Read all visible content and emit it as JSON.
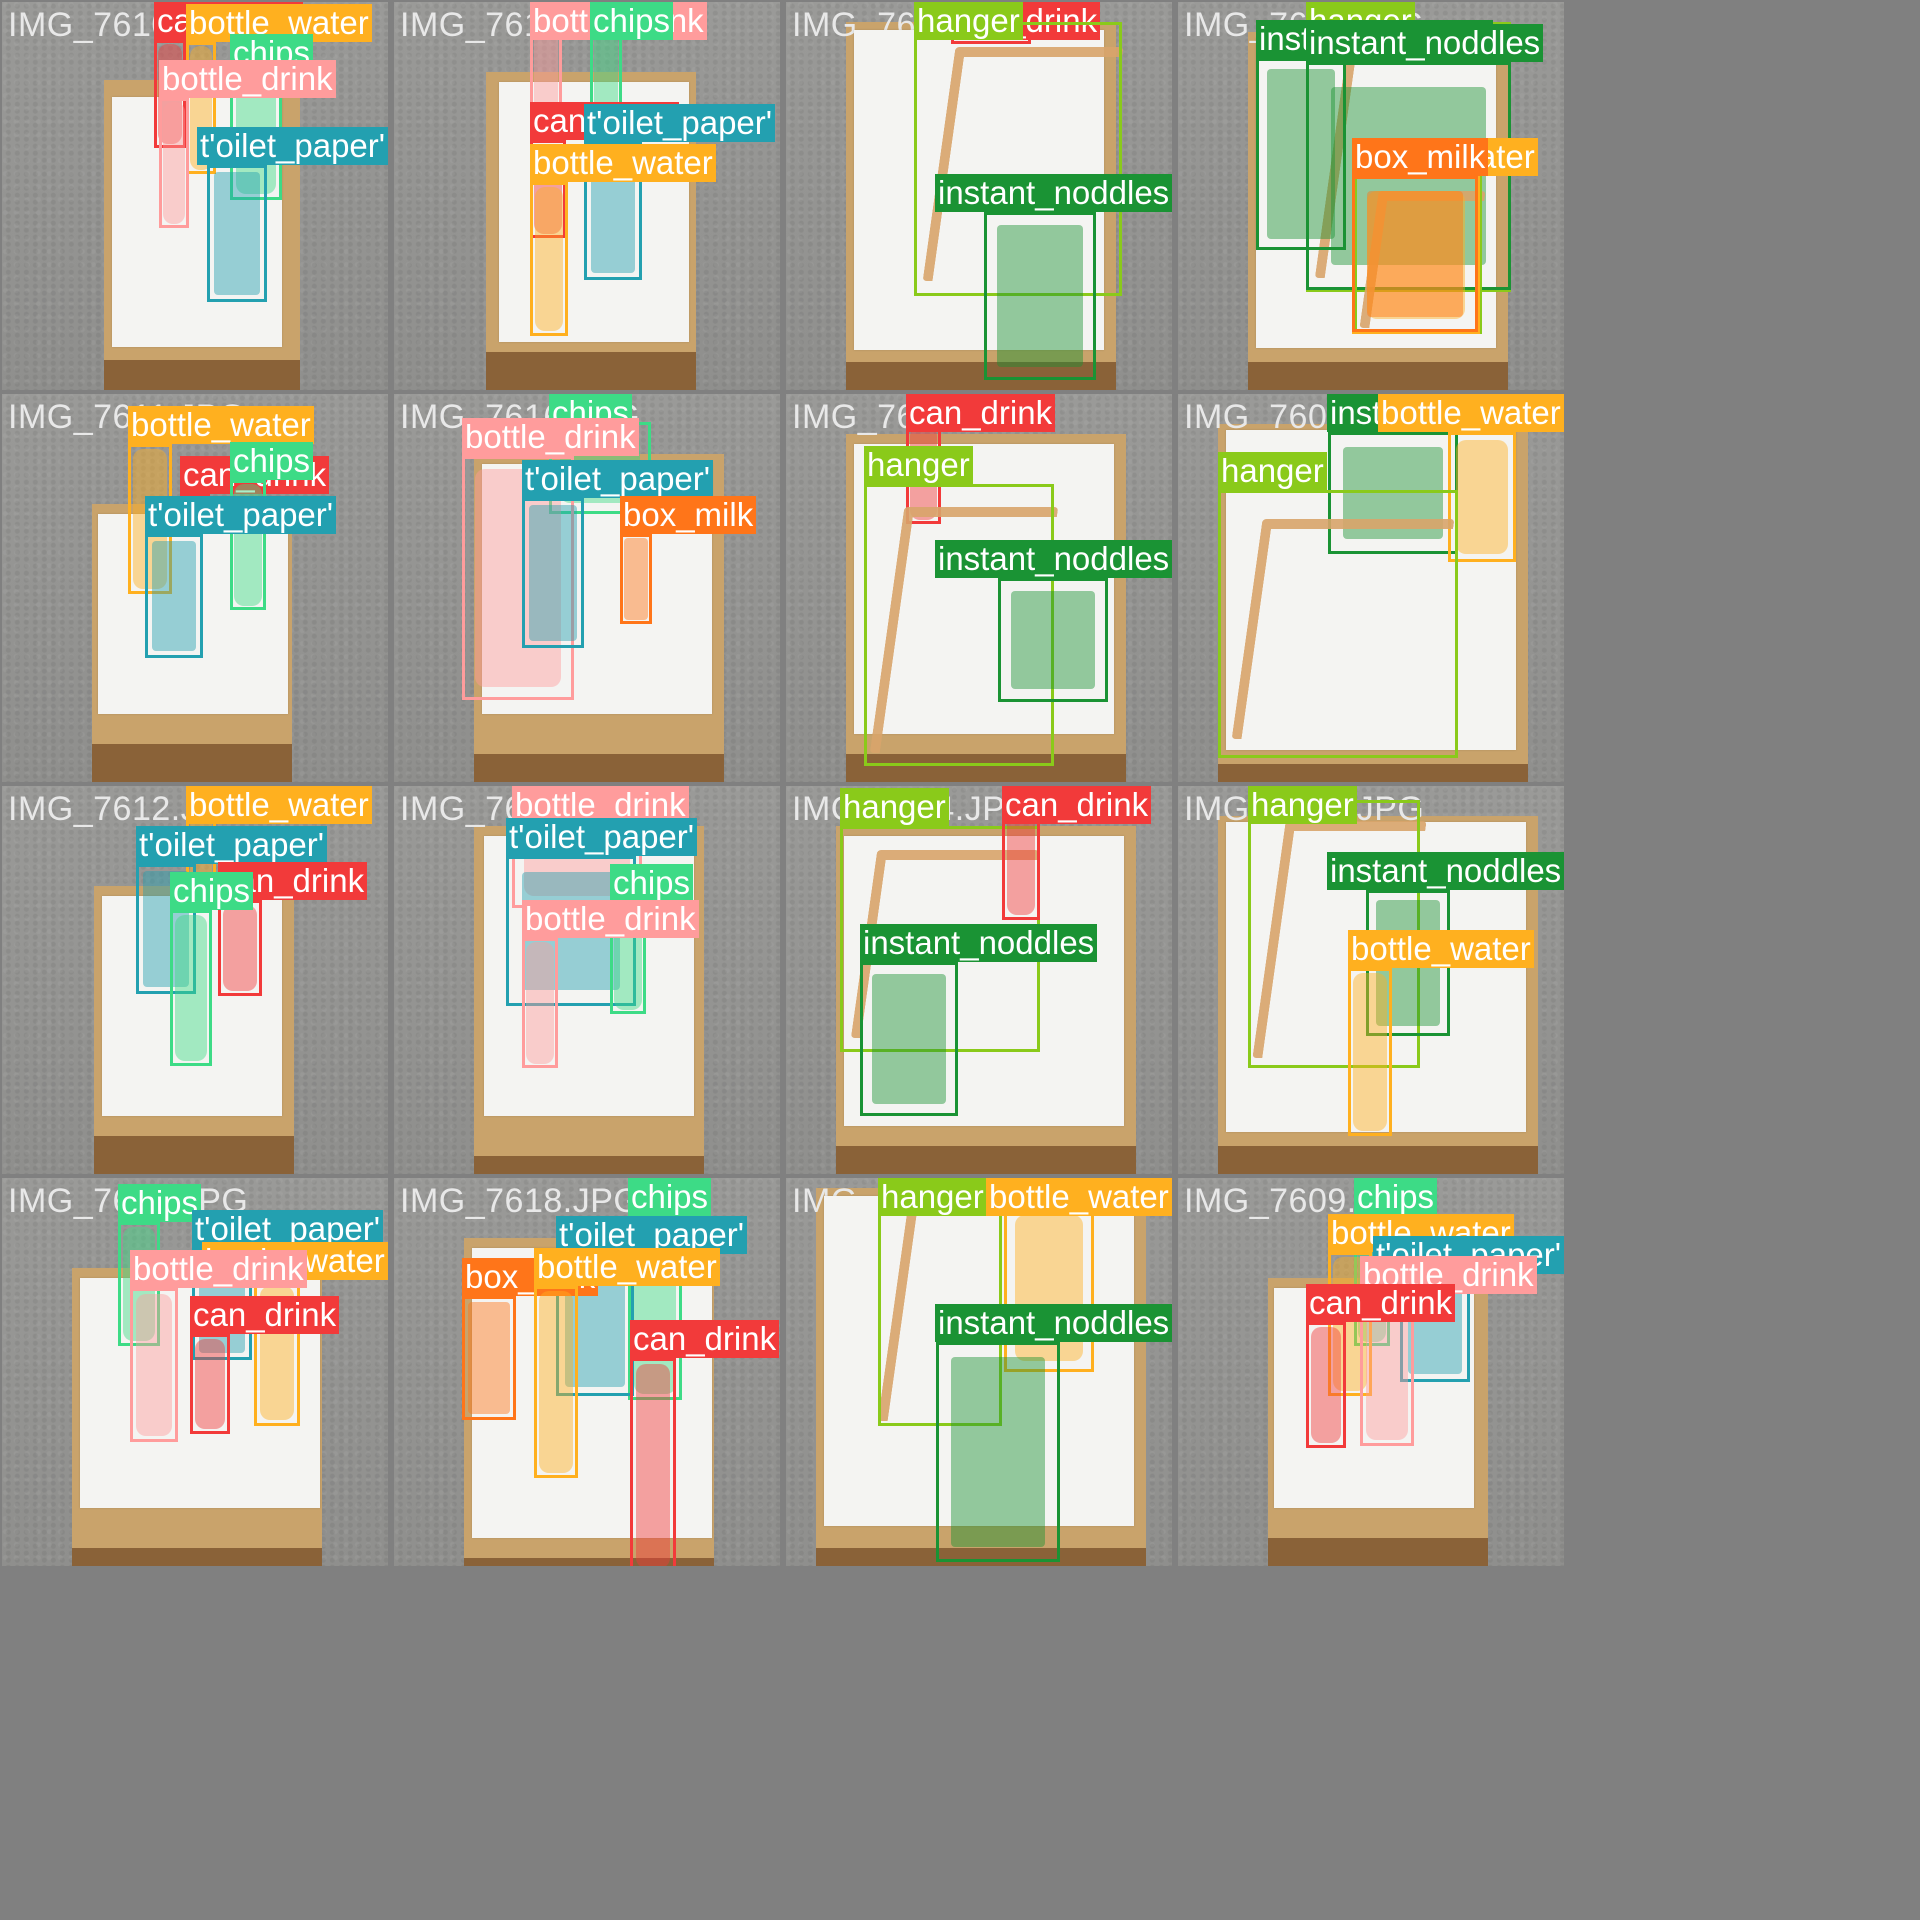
{
  "classes": {
    "bottle_water": "#FFB01F",
    "bottle_drink": "#FF9C9C",
    "can_drink": "#F23A3A",
    "chips": "#3DDB86",
    "t_oilet_paper": "#23A0B0",
    "box_milk": "#FF7519",
    "hanger": "#8ACA1A",
    "instant_noddles": "#1A9334"
  },
  "tiles": [
    {
      "filename": "IMG_7610.JPG",
      "objects": [
        {
          "cls": "can_drink",
          "label": "can_drink"
        },
        {
          "cls": "bottle_water",
          "label": "bottle_water"
        },
        {
          "cls": "chips",
          "label": "chips"
        },
        {
          "cls": "bottle_drink",
          "label": "bottle_drink"
        },
        {
          "cls": "t_oilet_paper",
          "label": "t'oilet_paper'"
        }
      ]
    },
    {
      "filename": "IMG_7614.JPG",
      "objects": [
        {
          "cls": "bottle_drink",
          "label": "bottle_drink"
        },
        {
          "cls": "chips",
          "label": "chips"
        },
        {
          "cls": "can_drink",
          "label": "can_drink"
        },
        {
          "cls": "t_oilet_paper",
          "label": "t'oilet_paper'"
        },
        {
          "cls": "bottle_water",
          "label": "bottle_water"
        }
      ]
    },
    {
      "filename": "IMG_7602.JPG",
      "objects": [
        {
          "cls": "can_drink",
          "label": "can_drink"
        },
        {
          "cls": "hanger",
          "label": "hanger"
        },
        {
          "cls": "instant_noddles",
          "label": "instant_noddles"
        }
      ]
    },
    {
      "filename": "IMG_7606.JPG",
      "objects": [
        {
          "cls": "hanger",
          "label": "hanger"
        },
        {
          "cls": "instant_noddles",
          "label": "instant_noddles"
        },
        {
          "cls": "instant_noddles",
          "label": "instant_noddles"
        },
        {
          "cls": "hanger",
          "label": "hanger"
        },
        {
          "cls": "bottle_water",
          "label": "bottle_water"
        },
        {
          "cls": "box_milk",
          "label": "box_milk"
        }
      ]
    },
    {
      "filename": "IMG_7611.JPG",
      "objects": [
        {
          "cls": "bottle_water",
          "label": "bottle_water"
        },
        {
          "cls": "can_drink",
          "label": "can_drink"
        },
        {
          "cls": "chips",
          "label": "chips"
        },
        {
          "cls": "t_oilet_paper",
          "label": "t'oilet_paper'"
        }
      ]
    },
    {
      "filename": "IMG_7616.JPG",
      "objects": [
        {
          "cls": "chips",
          "label": "chips"
        },
        {
          "cls": "bottle_drink",
          "label": "bottle_drink"
        },
        {
          "cls": "t_oilet_paper",
          "label": "t'oilet_paper'"
        },
        {
          "cls": "box_milk",
          "label": "box_milk"
        }
      ]
    },
    {
      "filename": "IMG_7603.JPG",
      "objects": [
        {
          "cls": "can_drink",
          "label": "can_drink"
        },
        {
          "cls": "hanger",
          "label": "hanger"
        },
        {
          "cls": "instant_noddles",
          "label": "instant_noddles"
        }
      ]
    },
    {
      "filename": "IMG_7607.JPG",
      "objects": [
        {
          "cls": "instant_noddles",
          "label": "instant_noddles"
        },
        {
          "cls": "bottle_water",
          "label": "bottle_water"
        },
        {
          "cls": "hanger",
          "label": "hanger"
        }
      ]
    },
    {
      "filename": "IMG_7612.JPG",
      "objects": [
        {
          "cls": "bottle_water",
          "label": "bottle_water"
        },
        {
          "cls": "t_oilet_paper",
          "label": "t'oilet_paper'"
        },
        {
          "cls": "can_drink",
          "label": "can_drink"
        },
        {
          "cls": "chips",
          "label": "chips"
        }
      ]
    },
    {
      "filename": "IMG_7617.JPG",
      "objects": [
        {
          "cls": "bottle_drink",
          "label": "bottle_drink"
        },
        {
          "cls": "t_oilet_paper",
          "label": "t'oilet_paper'"
        },
        {
          "cls": "chips",
          "label": "chips"
        },
        {
          "cls": "bottle_drink",
          "label": "bottle_drink"
        }
      ]
    },
    {
      "filename": "IMG_7604.JPG",
      "objects": [
        {
          "cls": "hanger",
          "label": "hanger"
        },
        {
          "cls": "can_drink",
          "label": "can_drink"
        },
        {
          "cls": "instant_noddles",
          "label": "instant_noddles"
        }
      ]
    },
    {
      "filename": "IMG_7608.JPG",
      "objects": [
        {
          "cls": "hanger",
          "label": "hanger"
        },
        {
          "cls": "instant_noddles",
          "label": "instant_noddles"
        },
        {
          "cls": "bottle_water",
          "label": "bottle_water"
        }
      ]
    },
    {
      "filename": "IMG_7613.JPG",
      "objects": [
        {
          "cls": "chips",
          "label": "chips"
        },
        {
          "cls": "t_oilet_paper",
          "label": "t'oilet_paper'"
        },
        {
          "cls": "bottle_water",
          "label": "bottle_water"
        },
        {
          "cls": "bottle_drink",
          "label": "bottle_drink"
        },
        {
          "cls": "can_drink",
          "label": "can_drink"
        }
      ]
    },
    {
      "filename": "IMG_7618.JPG",
      "objects": [
        {
          "cls": "chips",
          "label": "chips"
        },
        {
          "cls": "t_oilet_paper",
          "label": "t'oilet_paper'"
        },
        {
          "cls": "box_milk",
          "label": "box_milk"
        },
        {
          "cls": "bottle_water",
          "label": "bottle_water"
        },
        {
          "cls": "can_drink",
          "label": "can_drink"
        }
      ]
    },
    {
      "filename": "IMG_7605.JPG",
      "objects": [
        {
          "cls": "hanger",
          "label": "hanger"
        },
        {
          "cls": "bottle_water",
          "label": "bottle_water"
        },
        {
          "cls": "instant_noddles",
          "label": "instant_noddles"
        }
      ]
    },
    {
      "filename": "IMG_7609.JPG",
      "objects": [
        {
          "cls": "chips",
          "label": "chips"
        },
        {
          "cls": "bottle_water",
          "label": "bottle_water"
        },
        {
          "cls": "t_oilet_paper",
          "label": "t'oilet_paper'"
        },
        {
          "cls": "bottle_drink",
          "label": "bottle_drink"
        },
        {
          "cls": "can_drink",
          "label": "can_drink"
        }
      ]
    }
  ]
}
